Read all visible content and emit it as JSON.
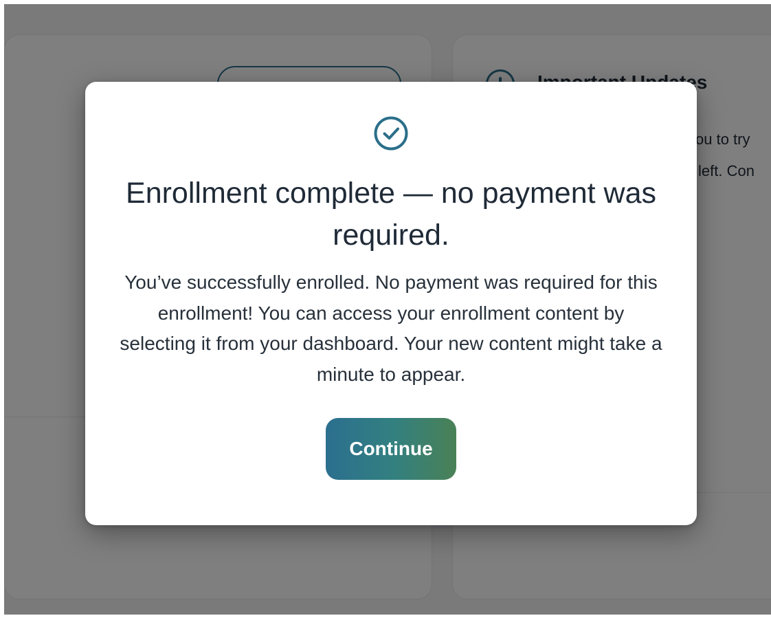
{
  "background": {
    "card_heading": "Important Updates",
    "card_text_line_1": "you to try",
    "card_text_line_2": "left. Con"
  },
  "modal": {
    "title": "Enrollment complete — no payment was required.",
    "message": "You’ve successfully enrolled. No payment was required for this enrollment! You can access your enrollment content by selecting it from your dashboard. Your new content might take a minute to appear.",
    "continue_label": "Continue"
  },
  "icons": {
    "success": "check-circle-icon",
    "background_info": "info-circle-icon"
  },
  "colors": {
    "accent": "#2b6f8a",
    "button_gradient_start": "#2b6f8f",
    "button_gradient_end": "#4a8156",
    "text": "#1f2a37",
    "overlay": "rgba(0,0,0,0.5)"
  }
}
